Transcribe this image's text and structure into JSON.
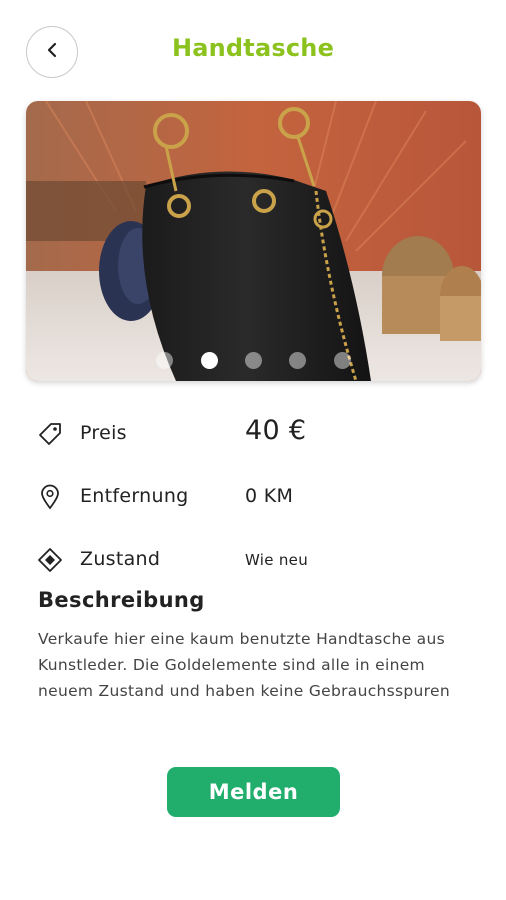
{
  "header": {
    "title": "Handtasche",
    "back_icon": "chevron-left-icon"
  },
  "gallery": {
    "image_count": 5,
    "active_index": 1,
    "image_description_icon": "product-photo"
  },
  "details": {
    "price": {
      "icon": "tag-icon",
      "label": "Preis",
      "value": "40 €"
    },
    "distance": {
      "icon": "location-pin-icon",
      "label": "Entfernung",
      "value": "0 KM"
    },
    "condition": {
      "icon": "diamond-icon",
      "label": "Zustand",
      "value": "Wie neu"
    }
  },
  "description": {
    "title": "Beschreibung",
    "text": "Verkaufe hier eine kaum benutzte Handtasche aus Kunstleder. Die Goldelemente sind alle in einem neuem Zustand und haben keine Gebrauchsspuren"
  },
  "actions": {
    "report_label": "Melden"
  },
  "colors": {
    "title": "#8cc21d",
    "button": "#21ad6c"
  }
}
